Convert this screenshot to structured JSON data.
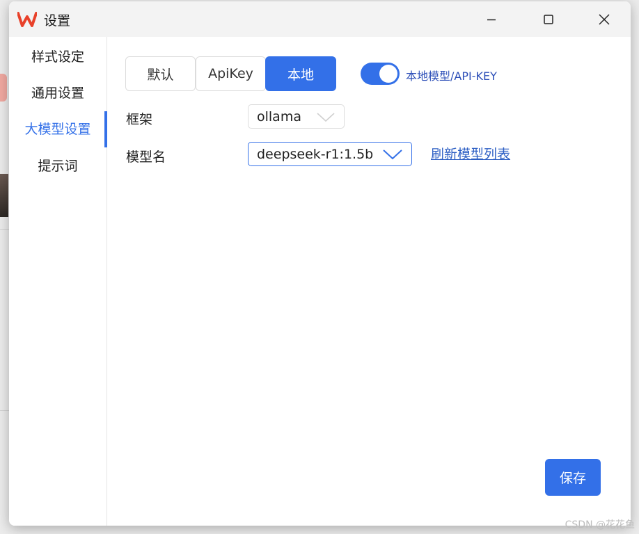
{
  "window": {
    "title": "设置",
    "logo_color": "#e8412a",
    "accent_color": "#3370e8"
  },
  "sidebar": {
    "items": [
      {
        "label": "样式设定",
        "active": false
      },
      {
        "label": "通用设置",
        "active": false
      },
      {
        "label": "大模型设置",
        "active": true
      },
      {
        "label": "提示词",
        "active": false
      }
    ]
  },
  "main": {
    "segments": [
      {
        "label": "默认",
        "active": false
      },
      {
        "label": "ApiKey",
        "active": false
      },
      {
        "label": "本地",
        "active": true
      }
    ],
    "toggle": {
      "on": true,
      "label": "本地模型/API-KEY"
    },
    "framework": {
      "label": "框架",
      "value": "ollama"
    },
    "model": {
      "label": "模型名",
      "value": "deepseek-r1:1.5b"
    },
    "refresh_link": "刷新模型列表",
    "save_label": "保存"
  },
  "watermark": "CSDN @花花鱼"
}
